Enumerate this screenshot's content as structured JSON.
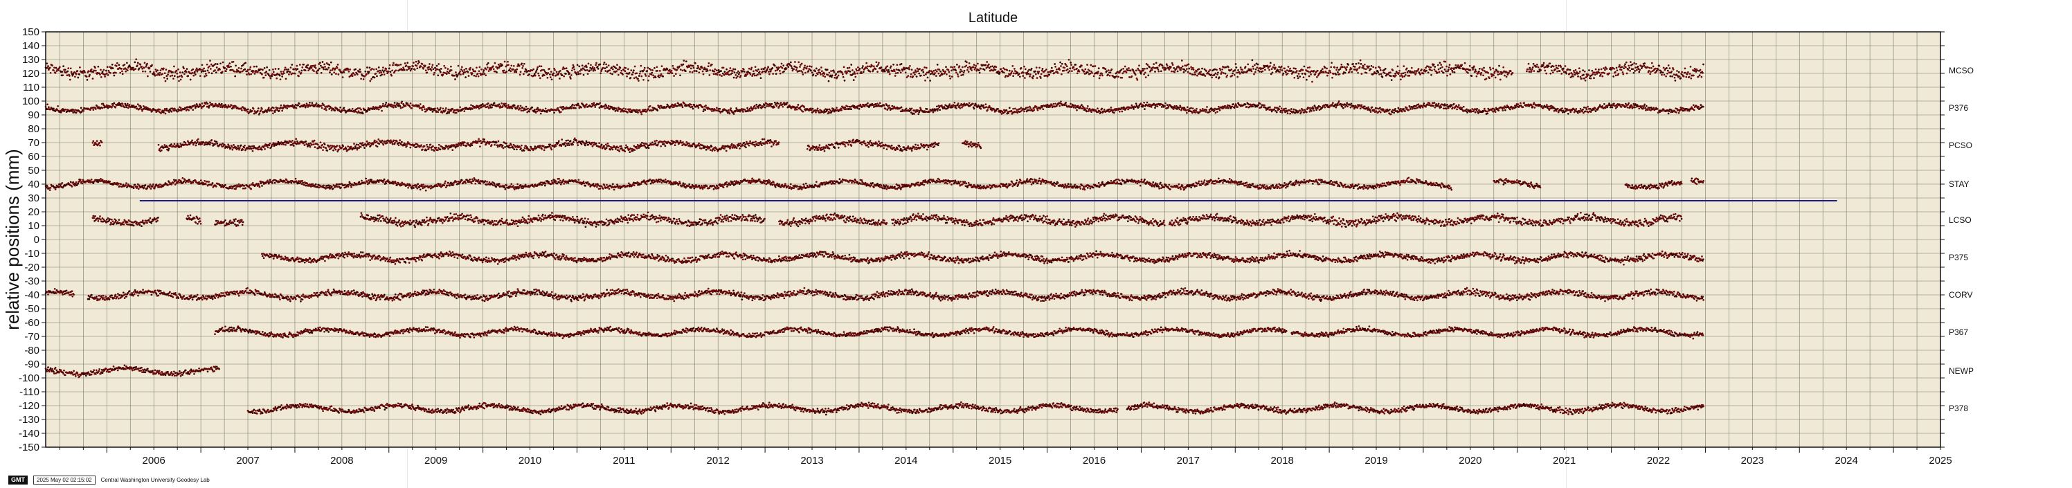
{
  "colors": {
    "background": "#efe9d5",
    "grid": "#7a7a6a",
    "points": "#6b0a0a",
    "points_dark": "#3a0000",
    "hline": "#1a1a8c",
    "frame": "#111111"
  },
  "footer": {
    "logo": "GMT",
    "timestamp": "2025 May 02 02:15:02",
    "credit": "Central Washington University Geodesy Lab"
  },
  "chart_data": {
    "type": "scatter",
    "title": "Latitude",
    "ylabel": "relative positions (mm)",
    "xlabel": "",
    "xlim": [
      2005.35,
      2025.5
    ],
    "ylim": [
      -150,
      150
    ],
    "x_ticks": [
      2006,
      2007,
      2008,
      2009,
      2010,
      2011,
      2012,
      2013,
      2014,
      2015,
      2016,
      2017,
      2018,
      2019,
      2020,
      2021,
      2022,
      2023,
      2024,
      2025
    ],
    "y_ticks": [
      -150,
      -140,
      -130,
      -120,
      -110,
      -100,
      -90,
      -80,
      -70,
      -60,
      -50,
      -40,
      -30,
      -20,
      -10,
      0,
      10,
      20,
      30,
      40,
      50,
      60,
      70,
      80,
      90,
      100,
      110,
      120,
      130,
      140,
      150
    ],
    "grid": true,
    "reference_line": {
      "y": 28,
      "x": [
        2006.35,
        2024.4
      ]
    },
    "series": [
      {
        "name": "MCSO",
        "offset": 122,
        "scatter": 3.2,
        "segments": [
          [
            2005.35,
            2020.95
          ],
          [
            2021.1,
            2022.98
          ]
        ]
      },
      {
        "name": "P376",
        "offset": 95,
        "scatter": 1.4,
        "segments": [
          [
            2005.35,
            2022.98
          ]
        ]
      },
      {
        "name": "PCSO",
        "offset": 68,
        "scatter": 1.6,
        "segments": [
          [
            2005.85,
            2005.95
          ],
          [
            2006.55,
            2013.15
          ],
          [
            2013.45,
            2014.85
          ],
          [
            2015.1,
            2015.3
          ]
        ]
      },
      {
        "name": "STAY",
        "offset": 40,
        "scatter": 1.3,
        "segments": [
          [
            2005.35,
            2020.3
          ],
          [
            2020.75,
            2021.25
          ],
          [
            2022.15,
            2022.75
          ],
          [
            2022.85,
            2022.98
          ]
        ]
      },
      {
        "name": "LCSO",
        "offset": 14,
        "scatter": 1.8,
        "segments": [
          [
            2005.85,
            2006.55
          ],
          [
            2006.85,
            2007.0
          ],
          [
            2007.15,
            2007.45
          ],
          [
            2008.7,
            2013.0
          ],
          [
            2013.15,
            2014.3
          ],
          [
            2014.35,
            2017.25
          ],
          [
            2017.3,
            2022.75
          ]
        ]
      },
      {
        "name": "P375",
        "offset": -13,
        "scatter": 1.5,
        "segments": [
          [
            2007.65,
            2022.98
          ]
        ]
      },
      {
        "name": "CORV",
        "offset": -40,
        "scatter": 1.5,
        "segments": [
          [
            2005.35,
            2005.65
          ],
          [
            2005.8,
            2022.98
          ]
        ]
      },
      {
        "name": "P367",
        "offset": -67,
        "scatter": 1.2,
        "segments": [
          [
            2007.15,
            2018.55
          ],
          [
            2018.6,
            2022.98
          ]
        ]
      },
      {
        "name": "NEWP",
        "offset": -95,
        "scatter": 1.3,
        "segments": [
          [
            2005.35,
            2007.2
          ]
        ]
      },
      {
        "name": "P378",
        "offset": -122,
        "scatter": 1.3,
        "segments": [
          [
            2007.5,
            2016.75
          ],
          [
            2016.85,
            2022.98
          ]
        ]
      }
    ]
  }
}
